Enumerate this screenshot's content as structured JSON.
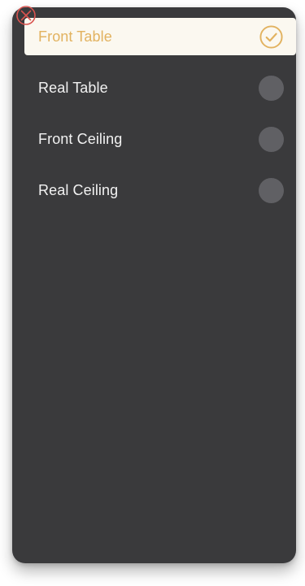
{
  "menu": {
    "options": [
      {
        "label": "Front Table",
        "selected": true
      },
      {
        "label": "Real Table",
        "selected": false
      },
      {
        "label": "Front Ceiling",
        "selected": false
      },
      {
        "label": "Real Ceiling",
        "selected": false
      }
    ]
  },
  "icons": {
    "close": "close-icon",
    "selected": "check-circle-icon",
    "unselected": "radio-unselected-icon"
  },
  "colors": {
    "panel_background": "#3a3a3c",
    "selected_row_background": "#fbf8f0",
    "accent": "#e2b25f",
    "radio_unselected": "#606064",
    "close_icon": "#d9534f"
  }
}
